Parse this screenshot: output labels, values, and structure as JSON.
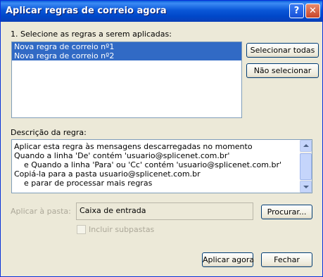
{
  "window": {
    "title": "Aplicar regras de correio agora",
    "help_button": "?",
    "close_button": "✕"
  },
  "rules": {
    "label": "1. Selecione as regras a serem aplicadas:",
    "items": [
      {
        "label": "Nova regra de correio nº1",
        "selected": true,
        "checked": false
      },
      {
        "label": "Nova regra de correio nº2",
        "selected": true,
        "checked": false
      }
    ],
    "select_all_button": "Selecionar todas",
    "select_none_button": "Não selecionar"
  },
  "description": {
    "label": "Descrição da regra:",
    "lines": [
      "Aplicar esta regra às mensagens descarregadas no momento",
      "Quando a linha 'De' contém 'usuario@splicenet.com.br'",
      "    e Quando a linha 'Para' ou 'Cc' contém 'usuario@splicenet.com.br'",
      "Copiá-la para a pasta usuario@splicenet.com.br",
      "    e parar de processar mais regras"
    ]
  },
  "apply_folder": {
    "label": "Aplicar à pasta:",
    "value": "Caixa de entrada",
    "browse_button": "Procurar..."
  },
  "include_subfolders": {
    "label": "Incluir subpastas",
    "checked": false,
    "enabled": false
  },
  "footer": {
    "apply_button": "Aplicar agora",
    "close_button": "Fechar"
  },
  "colors": {
    "title_bar": "#0a57d8",
    "selection": "#316ac5",
    "dialog_bg": "#ece9d8"
  }
}
